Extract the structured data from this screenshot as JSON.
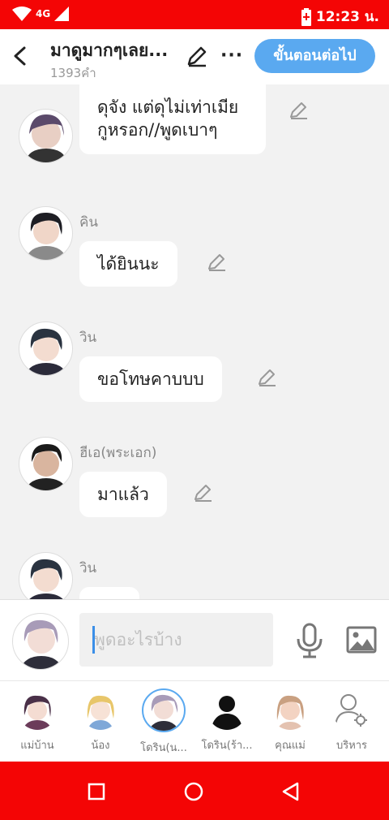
{
  "status": {
    "network": "4G",
    "time": "12:23 น."
  },
  "header": {
    "title": "มาดูมากๆเลย...",
    "subtitle": "1393คำ",
    "next_label": "ขั้นตอนต่อไป"
  },
  "messages": [
    {
      "speaker": "",
      "text": "ดุจัง แต่ดุไม่เท่าเมียกูหรอก//พูดเบาๆ"
    },
    {
      "speaker": "คิน",
      "text": "ได้ยินนะ"
    },
    {
      "speaker": "วิน",
      "text": "ขอโทษคาบบบ"
    },
    {
      "speaker": "ฮีเอ(พระเอก)",
      "text": "มาแล้ว"
    },
    {
      "speaker": "วิน",
      "text": ""
    }
  ],
  "input": {
    "placeholder": "พูดอะไรบ้าง",
    "value": ""
  },
  "characters": [
    {
      "label": "แม่บ้าน"
    },
    {
      "label": "น้อง"
    },
    {
      "label": "โดริน(น..."
    },
    {
      "label": "โดริน(ร้า..."
    },
    {
      "label": "คุณแม่"
    },
    {
      "label": "บริหาร"
    }
  ],
  "colors": {
    "accent": "#5aa9f0",
    "statusbar": "#f40505",
    "navbar": "#f40505"
  }
}
